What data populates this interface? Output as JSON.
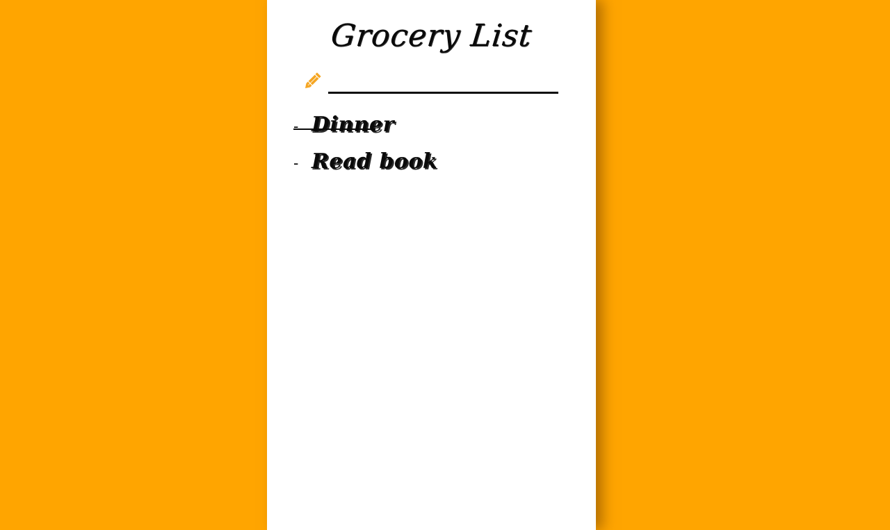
{
  "app": {
    "title": "Grocery List"
  },
  "input": {
    "value": "",
    "placeholder": ""
  },
  "icons": {
    "pencil": "pencil-icon"
  },
  "colors": {
    "background": "#ffa500",
    "card": "#ffffff",
    "accent": "#f5a623",
    "text": "#0a0a0a"
  },
  "items": [
    {
      "label": "Dinner",
      "done": true
    },
    {
      "label": "Read book",
      "done": false
    }
  ],
  "bullet": "-"
}
